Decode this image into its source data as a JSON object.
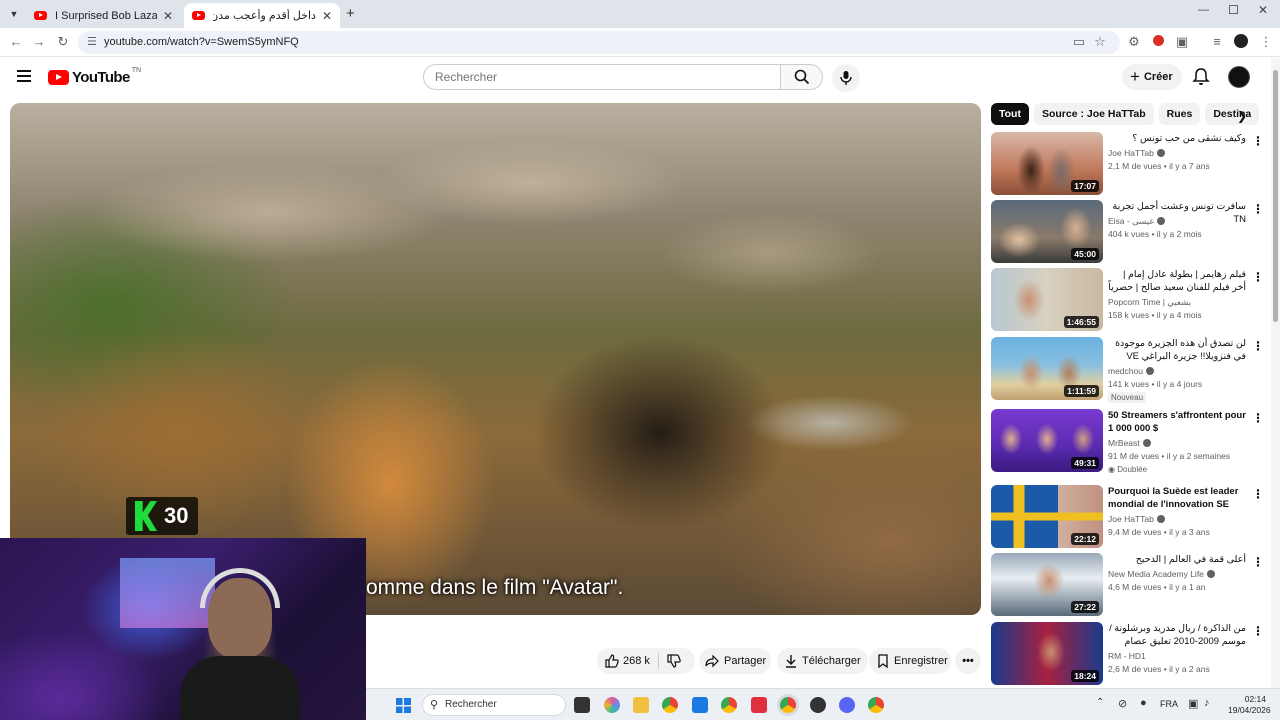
{
  "browser": {
    "tabs": [
      {
        "title": "I Surprised Bob Lazar With NAS"
      },
      {
        "title": "داخل أقدم وأعجب مدن العالم - قس"
      }
    ],
    "url": "youtube.com/watch?v=SwemS5ymNFQ"
  },
  "youtube": {
    "logo_text": "YouTube",
    "country_code": "TN",
    "search_placeholder": "Rechercher",
    "create_label": "Créer"
  },
  "player": {
    "subtitle": "omme dans le film \"Avatar\".",
    "channel_badge_number": "30"
  },
  "actions": {
    "likes": "268 k",
    "share": "Partager",
    "download": "Télécharger",
    "save": "Enregistrer"
  },
  "chips": [
    "Tout",
    "Source : Joe HaTTab",
    "Rues",
    "Destina"
  ],
  "recommendations": [
    {
      "title": "وكيف نشقى من حب تونس ؟",
      "title_rtl": true,
      "channel": "Joe HaTTab",
      "verified": true,
      "meta": "2,1 M de vues • il y a 7 ans",
      "duration": "17:07",
      "badge": ""
    },
    {
      "title": "سافرت تونس وعشت أجمل تجربة  TN",
      "title_rtl": true,
      "channel": "Eisa - عيسى",
      "verified": true,
      "meta": "404 k vues • il y a 2 mois",
      "duration": "45:00",
      "badge": ""
    },
    {
      "title": "فيلم زهايمر | بطولة عادل إمام | أخر فيلم للفنان سعيد صالح | حصرياً بجوده عالية",
      "title_rtl": true,
      "channel": "Popcorn Time | بشعبي",
      "verified": false,
      "meta": "158 k vues • il y a 4 mois",
      "duration": "1:46:55",
      "badge": ""
    },
    {
      "title": "لن تصدق أن هذه الجزيرة موجودة في فنزويلا!! جزيرة البراغي VE",
      "title_rtl": true,
      "channel": "medchou",
      "verified": true,
      "meta": "141 k vues • il y a 4 jours",
      "duration": "1:11:59",
      "badge": "Nouveau"
    },
    {
      "title": "50 Streamers s'affrontent pour 1 000 000 $",
      "title_rtl": false,
      "channel": "MrBeast",
      "verified": true,
      "meta": "91 M de vues • il y a 2 semaines",
      "duration": "49:31",
      "badge": "Doublée"
    },
    {
      "title": "Pourquoi la Suède est leader mondial de l'innovation SE",
      "title_rtl": false,
      "channel": "Joe HaTTab",
      "verified": true,
      "meta": "9,4 M de vues • il y a 3 ans",
      "duration": "22:12",
      "badge": ""
    },
    {
      "title": "أعلى قمة في العالم | الدحيح",
      "title_rtl": true,
      "channel": "New Media Academy Life",
      "verified": true,
      "meta": "4,6 M de vues • il y a 1 an",
      "duration": "27:22",
      "badge": ""
    },
    {
      "title": "من الذاكرة / ريال مدريد وبرشلونة / موسم 2009-2010 تعليق عصام الشوالي جودة",
      "title_rtl": true,
      "channel": "RM - HD1",
      "verified": false,
      "meta": "2,6 M de vues • il y a 2 ans",
      "duration": "18:24",
      "badge": ""
    }
  ],
  "taskbar": {
    "search": "Rechercher",
    "lang": "FRA",
    "time": "02:14",
    "date": "19/04/2026"
  },
  "colors": {
    "youtube_red": "#ff0000",
    "chip_active": "#0f0f0f",
    "k_logo_green": "#1edc3c"
  }
}
